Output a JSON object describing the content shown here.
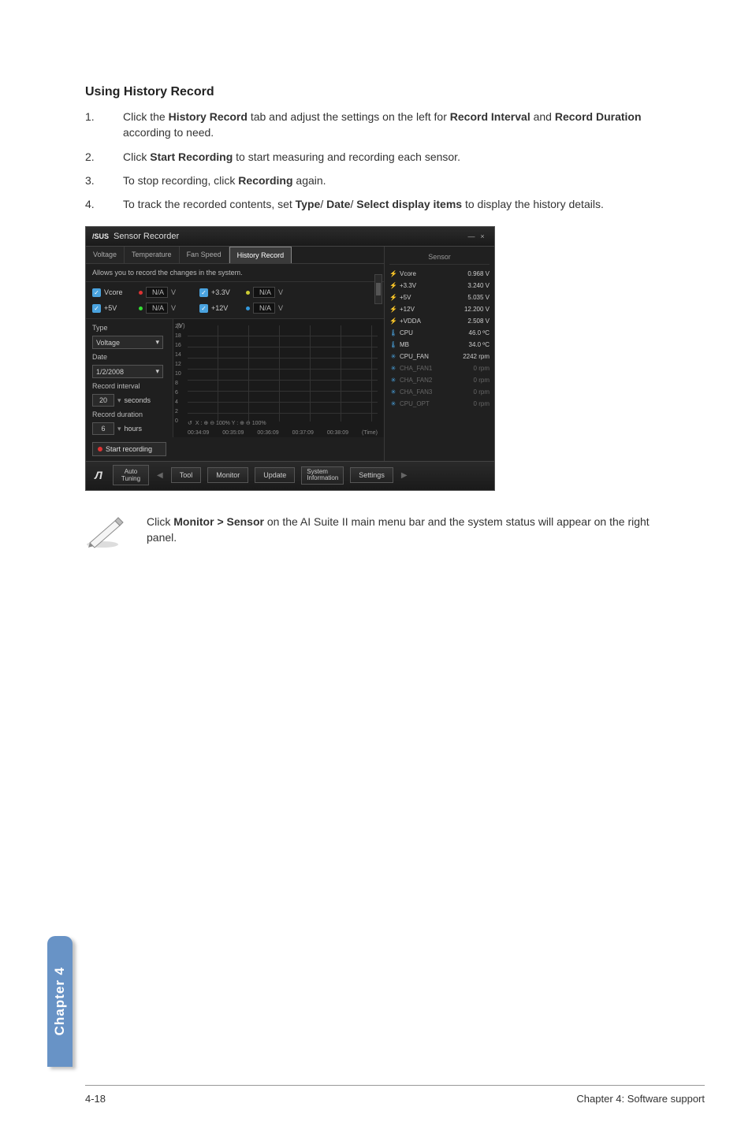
{
  "heading": "Using History Record",
  "steps": [
    {
      "num": "1.",
      "prefix": "Click the ",
      "b1": "History Record",
      "mid1": " tab and adjust the settings on the left for ",
      "b2": "Record Interval",
      "mid2": " and ",
      "b3": "Record Duration",
      "suffix": " according to need."
    },
    {
      "num": "2.",
      "prefix": "Click ",
      "b1": "Start Recording",
      "suffix": " to start measuring and recording each sensor."
    },
    {
      "num": "3.",
      "prefix": "To stop recording, click ",
      "b1": "Recording",
      "suffix": " again."
    },
    {
      "num": "4.",
      "prefix": "To track the recorded contents, set ",
      "b1": "Type",
      "mid1": "/ ",
      "b2": "Date",
      "mid2": "/ ",
      "b3": "Select display items",
      "suffix": " to display the history details."
    }
  ],
  "window": {
    "title": "Sensor Recorder",
    "min": "—",
    "close": "×",
    "tabs": [
      "Voltage",
      "Temperature",
      "Fan Speed",
      "History Record"
    ],
    "active_tab": 3,
    "msg": "Allows you to record the changes in the system.",
    "vrows": {
      "left": [
        {
          "name": "Vcore",
          "dot": "#d33",
          "val": "N/A",
          "unit": "V"
        },
        {
          "name": "+5V",
          "dot": "#3d3",
          "val": "N/A",
          "unit": "V"
        }
      ],
      "right": [
        {
          "name": "+3.3V",
          "dot": "#cc3",
          "val": "N/A",
          "unit": "V"
        },
        {
          "name": "+12V",
          "dot": "#39d",
          "val": "N/A",
          "unit": "V"
        }
      ]
    },
    "controls": {
      "type_label": "Type",
      "type_value": "Voltage",
      "date_label": "Date",
      "date_value": "1/2/2008",
      "interval_label": "Record interval",
      "interval_value": "20",
      "interval_unit": "seconds",
      "duration_label": "Record duration",
      "duration_value": "6",
      "duration_unit": "hours",
      "start_label": "Start recording"
    },
    "chart": {
      "y_unit": "(V)",
      "y_ticks": [
        "20",
        "18",
        "16",
        "14",
        "12",
        "10",
        "8",
        "6",
        "4",
        "2",
        "0"
      ],
      "x_ticks": [
        "00:34:09",
        "00:35:09",
        "00:36:09",
        "00:37:09",
        "00:38:09"
      ],
      "x_unit": "(Time)",
      "zoom": "X : ⊕ ⊖ 100%    Y : ⊕ ⊖ 100%",
      "reset": "↺"
    },
    "sensor_panel": {
      "header": "Sensor",
      "items": [
        {
          "icon": "bolt",
          "name": "Vcore",
          "val": "0.968 V",
          "dim": false
        },
        {
          "icon": "bolt",
          "name": "+3.3V",
          "val": "3.240 V",
          "dim": false
        },
        {
          "icon": "bolt",
          "name": "+5V",
          "val": "5.035 V",
          "dim": false
        },
        {
          "icon": "bolt",
          "name": "+12V",
          "val": "12.200 V",
          "dim": false
        },
        {
          "icon": "bolt",
          "name": "+VDDA",
          "val": "2.508 V",
          "dim": false
        },
        {
          "icon": "therm",
          "name": "CPU",
          "val": "46.0 ºC",
          "dim": false
        },
        {
          "icon": "therm",
          "name": "MB",
          "val": "34.0 ºC",
          "dim": false
        },
        {
          "icon": "fan",
          "name": "CPU_FAN",
          "val": "2242 rpm",
          "dim": false
        },
        {
          "icon": "fan",
          "name": "CHA_FAN1",
          "val": "0 rpm",
          "dim": true
        },
        {
          "icon": "fan",
          "name": "CHA_FAN2",
          "val": "0 rpm",
          "dim": true
        },
        {
          "icon": "fan",
          "name": "CHA_FAN3",
          "val": "0 rpm",
          "dim": true
        },
        {
          "icon": "fan",
          "name": "CPU_OPT",
          "val": "0 rpm",
          "dim": true
        }
      ]
    },
    "bottom": {
      "auto": "Auto\nTuning",
      "tool": "Tool",
      "monitor": "Monitor",
      "update": "Update",
      "sysinfo": "System\nInformation",
      "settings": "Settings"
    }
  },
  "note": "Click Monitor > Sensor on the AI Suite II main menu bar and the system status will appear on the right panel.",
  "note_b1": "Monitor > Sensor",
  "side_tab": "Chapter 4",
  "footer_left": "4-18",
  "footer_right": "Chapter 4: Software support"
}
